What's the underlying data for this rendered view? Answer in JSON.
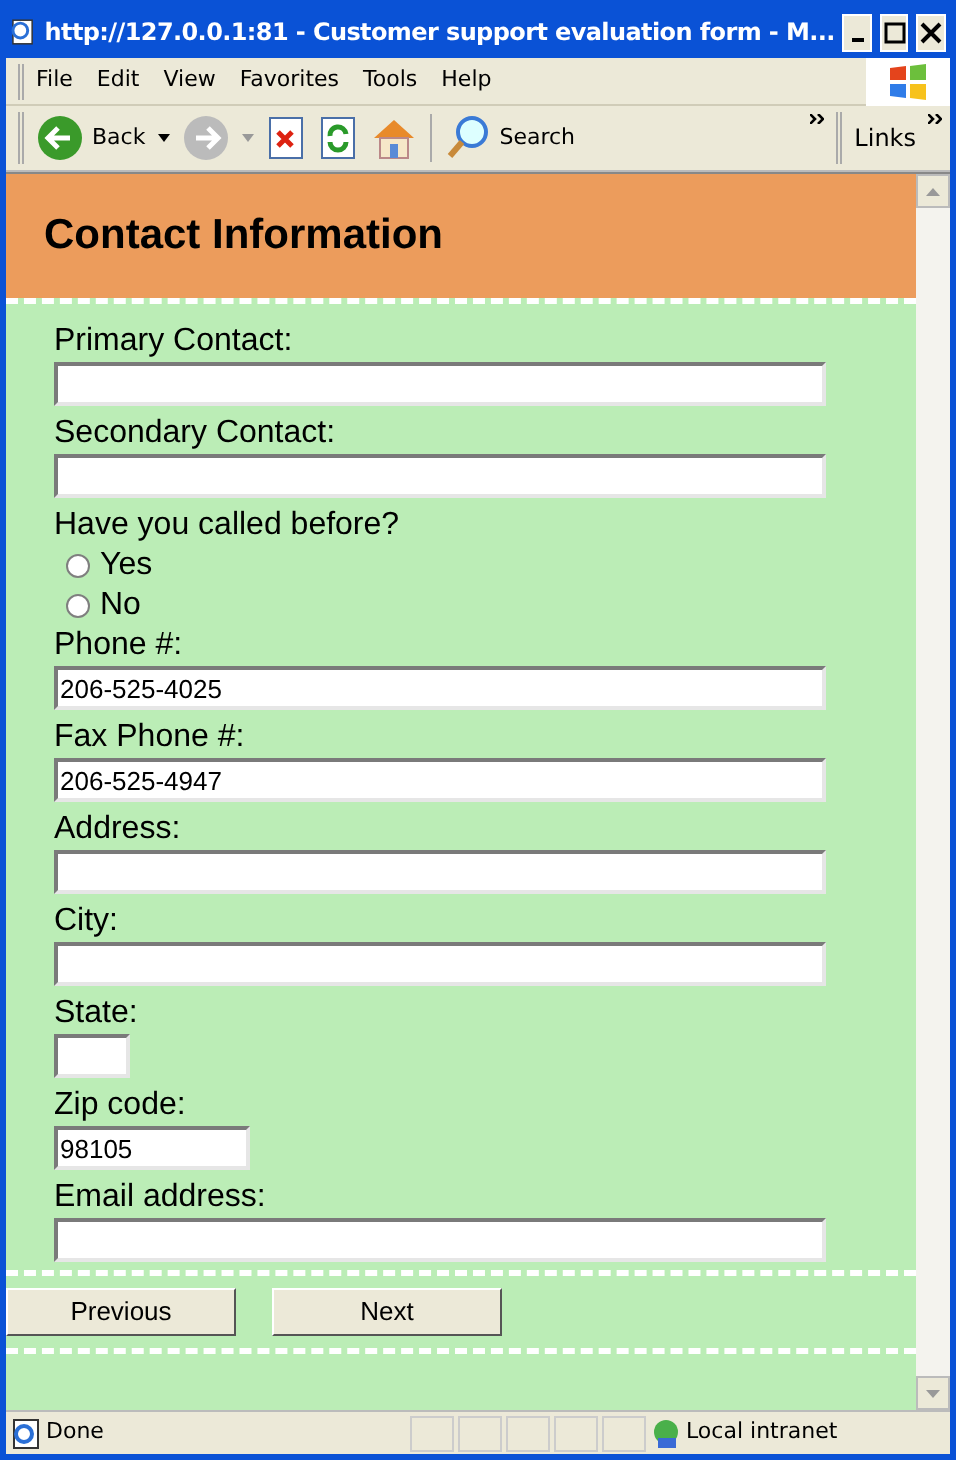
{
  "window": {
    "title": "http://127.0.0.1:81 - Customer support evaluation form - M..."
  },
  "menu": [
    "File",
    "Edit",
    "View",
    "Favorites",
    "Tools",
    "Help"
  ],
  "toolbar": {
    "back": "Back",
    "search": "Search",
    "links": "Links"
  },
  "section": {
    "title": "Contact Information"
  },
  "fields": [
    {
      "kind": "wide",
      "label": "Primary Contact:"
    },
    {
      "kind": "wide",
      "label": "Secondary Contact:"
    },
    {
      "kind": "radio",
      "label": "Have you called before?",
      "options": [
        {
          "label": "Yes",
          "selected": false
        },
        {
          "label": "No",
          "selected": false
        }
      ]
    },
    {
      "kind": "wide",
      "label": "Phone #:",
      "value": "206-525-4025"
    },
    {
      "kind": "wide",
      "label": "Fax Phone #:",
      "value": "206-525-4947"
    },
    {
      "kind": "wide",
      "label": "Address:"
    },
    {
      "kind": "wide",
      "label": "City:"
    },
    {
      "kind": "tiny",
      "label": "State:"
    },
    {
      "kind": "short",
      "label": "Zip code:",
      "value": "98105"
    },
    {
      "kind": "wide",
      "label": "Email address:"
    }
  ],
  "buttons": [
    "Previous",
    "Next"
  ],
  "status_bar": {
    "text": "Done",
    "zone": "Local intranet"
  }
}
